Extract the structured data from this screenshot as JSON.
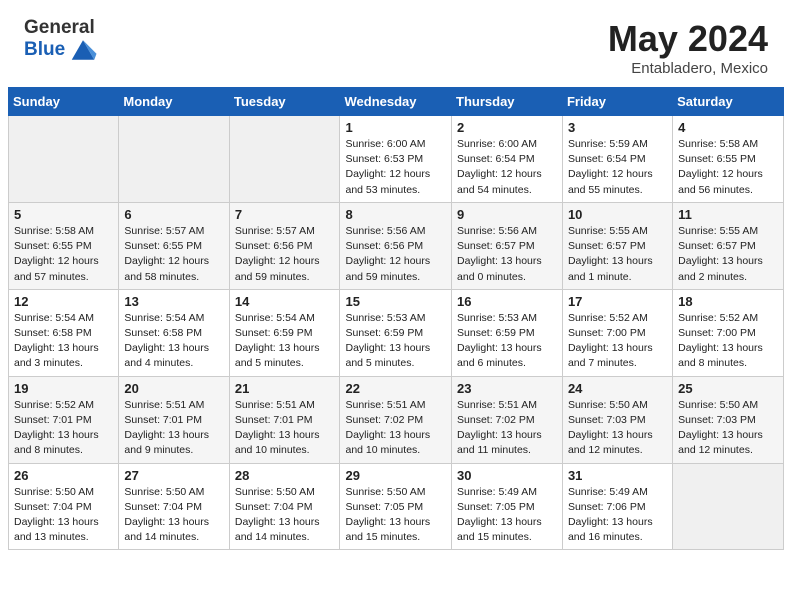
{
  "header": {
    "logo_general": "General",
    "logo_blue": "Blue",
    "title": "May 2024",
    "location": "Entabladero, Mexico"
  },
  "days_of_week": [
    "Sunday",
    "Monday",
    "Tuesday",
    "Wednesday",
    "Thursday",
    "Friday",
    "Saturday"
  ],
  "weeks": [
    [
      {
        "day": "",
        "info": ""
      },
      {
        "day": "",
        "info": ""
      },
      {
        "day": "",
        "info": ""
      },
      {
        "day": "1",
        "info": "Sunrise: 6:00 AM\nSunset: 6:53 PM\nDaylight: 12 hours\nand 53 minutes."
      },
      {
        "day": "2",
        "info": "Sunrise: 6:00 AM\nSunset: 6:54 PM\nDaylight: 12 hours\nand 54 minutes."
      },
      {
        "day": "3",
        "info": "Sunrise: 5:59 AM\nSunset: 6:54 PM\nDaylight: 12 hours\nand 55 minutes."
      },
      {
        "day": "4",
        "info": "Sunrise: 5:58 AM\nSunset: 6:55 PM\nDaylight: 12 hours\nand 56 minutes."
      }
    ],
    [
      {
        "day": "5",
        "info": "Sunrise: 5:58 AM\nSunset: 6:55 PM\nDaylight: 12 hours\nand 57 minutes."
      },
      {
        "day": "6",
        "info": "Sunrise: 5:57 AM\nSunset: 6:55 PM\nDaylight: 12 hours\nand 58 minutes."
      },
      {
        "day": "7",
        "info": "Sunrise: 5:57 AM\nSunset: 6:56 PM\nDaylight: 12 hours\nand 59 minutes."
      },
      {
        "day": "8",
        "info": "Sunrise: 5:56 AM\nSunset: 6:56 PM\nDaylight: 12 hours\nand 59 minutes."
      },
      {
        "day": "9",
        "info": "Sunrise: 5:56 AM\nSunset: 6:57 PM\nDaylight: 13 hours\nand 0 minutes."
      },
      {
        "day": "10",
        "info": "Sunrise: 5:55 AM\nSunset: 6:57 PM\nDaylight: 13 hours\nand 1 minute."
      },
      {
        "day": "11",
        "info": "Sunrise: 5:55 AM\nSunset: 6:57 PM\nDaylight: 13 hours\nand 2 minutes."
      }
    ],
    [
      {
        "day": "12",
        "info": "Sunrise: 5:54 AM\nSunset: 6:58 PM\nDaylight: 13 hours\nand 3 minutes."
      },
      {
        "day": "13",
        "info": "Sunrise: 5:54 AM\nSunset: 6:58 PM\nDaylight: 13 hours\nand 4 minutes."
      },
      {
        "day": "14",
        "info": "Sunrise: 5:54 AM\nSunset: 6:59 PM\nDaylight: 13 hours\nand 5 minutes."
      },
      {
        "day": "15",
        "info": "Sunrise: 5:53 AM\nSunset: 6:59 PM\nDaylight: 13 hours\nand 5 minutes."
      },
      {
        "day": "16",
        "info": "Sunrise: 5:53 AM\nSunset: 6:59 PM\nDaylight: 13 hours\nand 6 minutes."
      },
      {
        "day": "17",
        "info": "Sunrise: 5:52 AM\nSunset: 7:00 PM\nDaylight: 13 hours\nand 7 minutes."
      },
      {
        "day": "18",
        "info": "Sunrise: 5:52 AM\nSunset: 7:00 PM\nDaylight: 13 hours\nand 8 minutes."
      }
    ],
    [
      {
        "day": "19",
        "info": "Sunrise: 5:52 AM\nSunset: 7:01 PM\nDaylight: 13 hours\nand 8 minutes."
      },
      {
        "day": "20",
        "info": "Sunrise: 5:51 AM\nSunset: 7:01 PM\nDaylight: 13 hours\nand 9 minutes."
      },
      {
        "day": "21",
        "info": "Sunrise: 5:51 AM\nSunset: 7:01 PM\nDaylight: 13 hours\nand 10 minutes."
      },
      {
        "day": "22",
        "info": "Sunrise: 5:51 AM\nSunset: 7:02 PM\nDaylight: 13 hours\nand 10 minutes."
      },
      {
        "day": "23",
        "info": "Sunrise: 5:51 AM\nSunset: 7:02 PM\nDaylight: 13 hours\nand 11 minutes."
      },
      {
        "day": "24",
        "info": "Sunrise: 5:50 AM\nSunset: 7:03 PM\nDaylight: 13 hours\nand 12 minutes."
      },
      {
        "day": "25",
        "info": "Sunrise: 5:50 AM\nSunset: 7:03 PM\nDaylight: 13 hours\nand 12 minutes."
      }
    ],
    [
      {
        "day": "26",
        "info": "Sunrise: 5:50 AM\nSunset: 7:04 PM\nDaylight: 13 hours\nand 13 minutes."
      },
      {
        "day": "27",
        "info": "Sunrise: 5:50 AM\nSunset: 7:04 PM\nDaylight: 13 hours\nand 14 minutes."
      },
      {
        "day": "28",
        "info": "Sunrise: 5:50 AM\nSunset: 7:04 PM\nDaylight: 13 hours\nand 14 minutes."
      },
      {
        "day": "29",
        "info": "Sunrise: 5:50 AM\nSunset: 7:05 PM\nDaylight: 13 hours\nand 15 minutes."
      },
      {
        "day": "30",
        "info": "Sunrise: 5:49 AM\nSunset: 7:05 PM\nDaylight: 13 hours\nand 15 minutes."
      },
      {
        "day": "31",
        "info": "Sunrise: 5:49 AM\nSunset: 7:06 PM\nDaylight: 13 hours\nand 16 minutes."
      },
      {
        "day": "",
        "info": ""
      }
    ]
  ]
}
